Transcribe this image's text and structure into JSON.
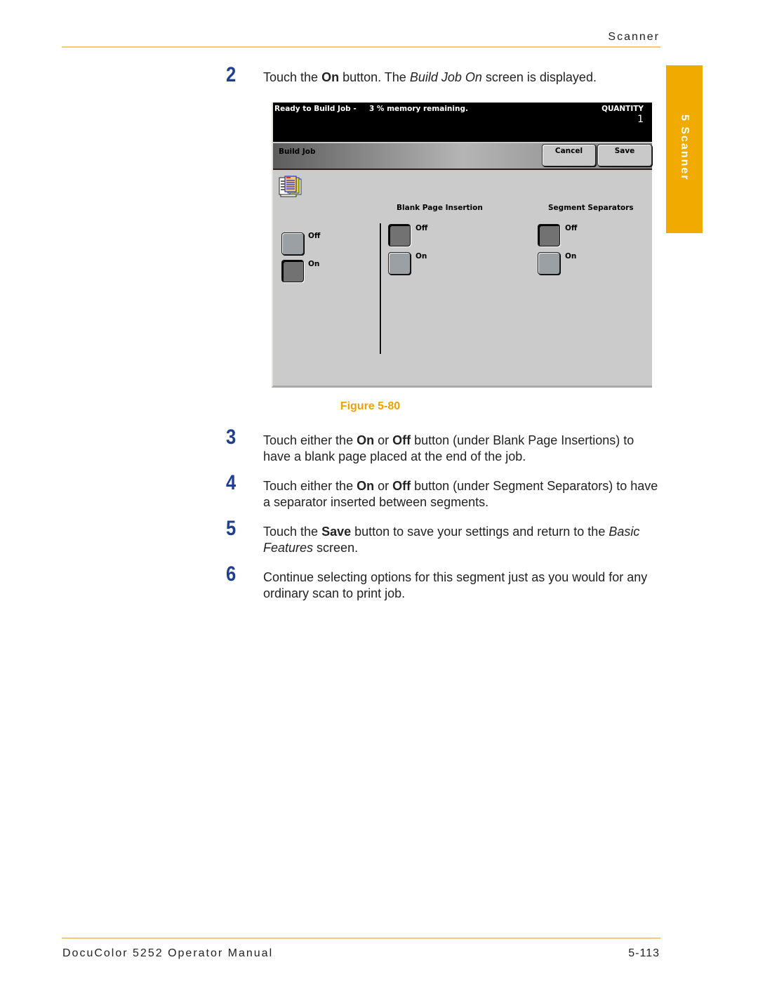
{
  "header": {
    "section": "Scanner"
  },
  "side_tab": {
    "label": "5 Scanner",
    "color": "#f0aa00"
  },
  "steps": [
    {
      "number": "2",
      "parts": [
        {
          "t": "Touch the "
        },
        {
          "t": "On",
          "b": true
        },
        {
          "t": " button. The "
        },
        {
          "t": "Build Job On",
          "i": true
        },
        {
          "t": " screen is displayed."
        }
      ]
    },
    {
      "number": "3",
      "parts": [
        {
          "t": "Touch either the "
        },
        {
          "t": "On",
          "b": true
        },
        {
          "t": " or "
        },
        {
          "t": "Off",
          "b": true
        },
        {
          "t": " button (under Blank Page Insertions) to have a blank page placed at the end of the job."
        }
      ]
    },
    {
      "number": "4",
      "parts": [
        {
          "t": "Touch either the "
        },
        {
          "t": "On",
          "b": true
        },
        {
          "t": " or "
        },
        {
          "t": "Off",
          "b": true
        },
        {
          "t": " button (under Segment Separators) to have a separator inserted between segments."
        }
      ]
    },
    {
      "number": "5",
      "parts": [
        {
          "t": "Touch the "
        },
        {
          "t": "Save",
          "b": true
        },
        {
          "t": " button to save your settings and return to the "
        },
        {
          "t": "Basic Features",
          "i": true
        },
        {
          "t": " screen."
        }
      ]
    },
    {
      "number": "6",
      "parts": [
        {
          "t": "Continue selecting options for this segment just as you would for any ordinary scan to print job."
        }
      ]
    }
  ],
  "screen": {
    "status": "Ready to Build Job -     3 % memory remaining.",
    "quantity_label": "QUANTITY",
    "quantity_value": "1",
    "title": "Build Job",
    "cancel_label": "Cancel",
    "save_label": "Save",
    "build_job": {
      "off_label": "Off",
      "on_label": "On",
      "selected": "On"
    },
    "blank_page_insertion": {
      "header": "Blank Page Insertion",
      "off_label": "Off",
      "on_label": "On",
      "selected": "Off"
    },
    "segment_separators": {
      "header": "Segment Separators",
      "off_label": "Off",
      "on_label": "On",
      "selected": "Off"
    }
  },
  "figure_caption": "Figure 5-80",
  "footer": {
    "title": "DocuColor 5252 Operator Manual",
    "page": "5-113"
  },
  "colors": {
    "accent": "#f0aa00",
    "step_number": "#1f3f8f",
    "rule": "#f6c97a"
  }
}
